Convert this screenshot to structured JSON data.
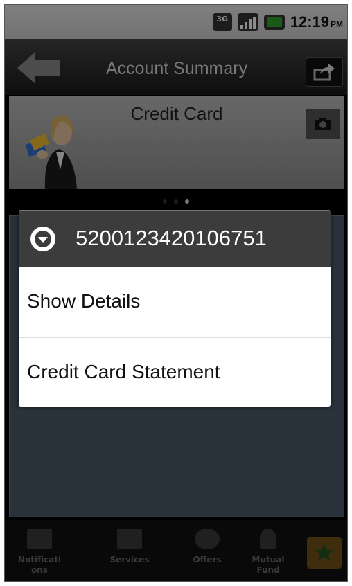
{
  "statusbar": {
    "network": "3G",
    "time": "12:19",
    "ampm": "PM"
  },
  "appbar": {
    "title": "Account Summary"
  },
  "banner": {
    "title": "Credit Card"
  },
  "dialog": {
    "title": "5200123420106751",
    "items": [
      {
        "label": "Show Details"
      },
      {
        "label": "Credit Card Statement"
      }
    ]
  },
  "tabs": [
    {
      "label": "Notifications",
      "icon": "id-card-icon"
    },
    {
      "label": "Services",
      "icon": "wallet-icon"
    },
    {
      "label": "Offers",
      "icon": "badge-icon"
    },
    {
      "label": "Mutual Fund",
      "icon": "money-bag-icon"
    }
  ],
  "colors": {
    "accent": "#c48a1e",
    "dialog_header": "#3c3c3c",
    "content_bg": "#4e5c6e"
  }
}
